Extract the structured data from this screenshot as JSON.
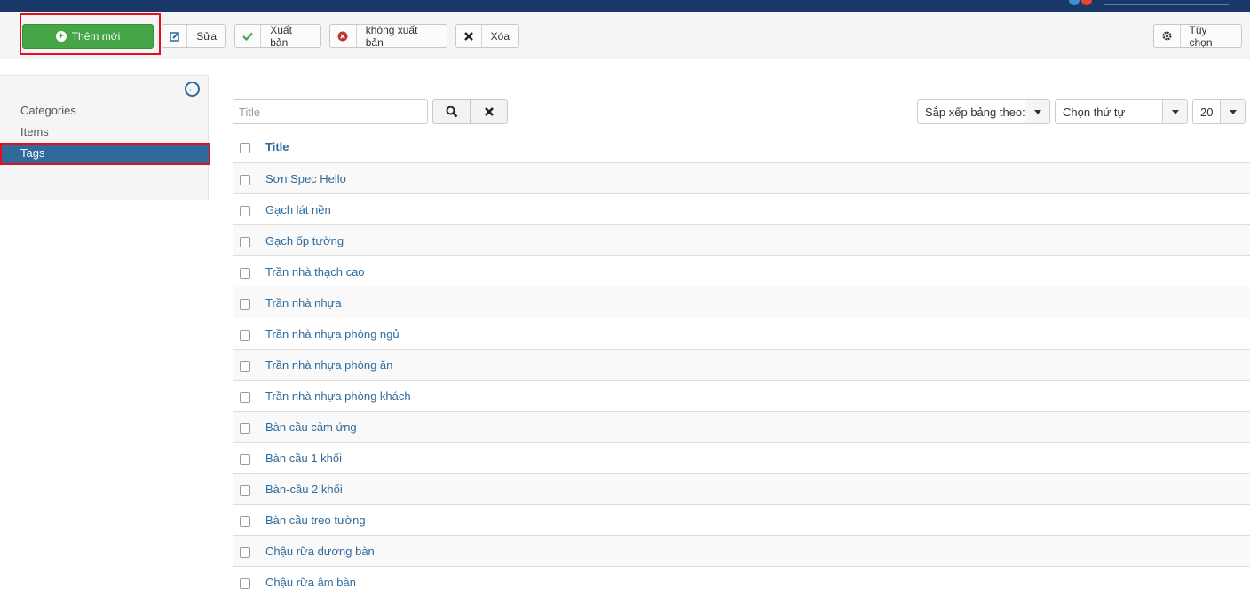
{
  "toolbar": {
    "new_label": "Thêm mới",
    "edit_label": "Sửa",
    "publish_label": "Xuất bản",
    "unpublish_label": "không xuất bản",
    "delete_label": "Xóa",
    "options_label": "Tùy chọn"
  },
  "sidebar": {
    "items": [
      {
        "label": "Categories"
      },
      {
        "label": "Items"
      },
      {
        "label": "Tags",
        "active": true
      }
    ]
  },
  "filter": {
    "search_placeholder": "Title",
    "sort_by": "Sắp xếp bảng theo:",
    "order": "Chọn thứ tự",
    "limit": "20"
  },
  "table": {
    "header": "Title",
    "rows": [
      "Sơn Spec Hello",
      "Gạch lát nền",
      "Gạch ốp tường",
      "Trần nhà thạch cao",
      "Trần nhà nhựa",
      "Trần nhà nhựa phòng ngủ",
      "Trần nhà nhựa phòng ăn",
      "Trần nhà nhựa phòng khách",
      "Bàn cầu cảm ứng",
      "Bàn cầu 1 khối",
      "Bàn-cầu 2 khối",
      "Bàn cầu treo tường",
      "Chậu rữa dương bàn",
      "Chậu rữa âm bàn"
    ]
  },
  "colors": {
    "header_bar": "#1a3867",
    "new_button": "#46a546",
    "link": "#2f6a9c",
    "active_item": "#2f6a9c",
    "highlight": "#e3101b"
  }
}
